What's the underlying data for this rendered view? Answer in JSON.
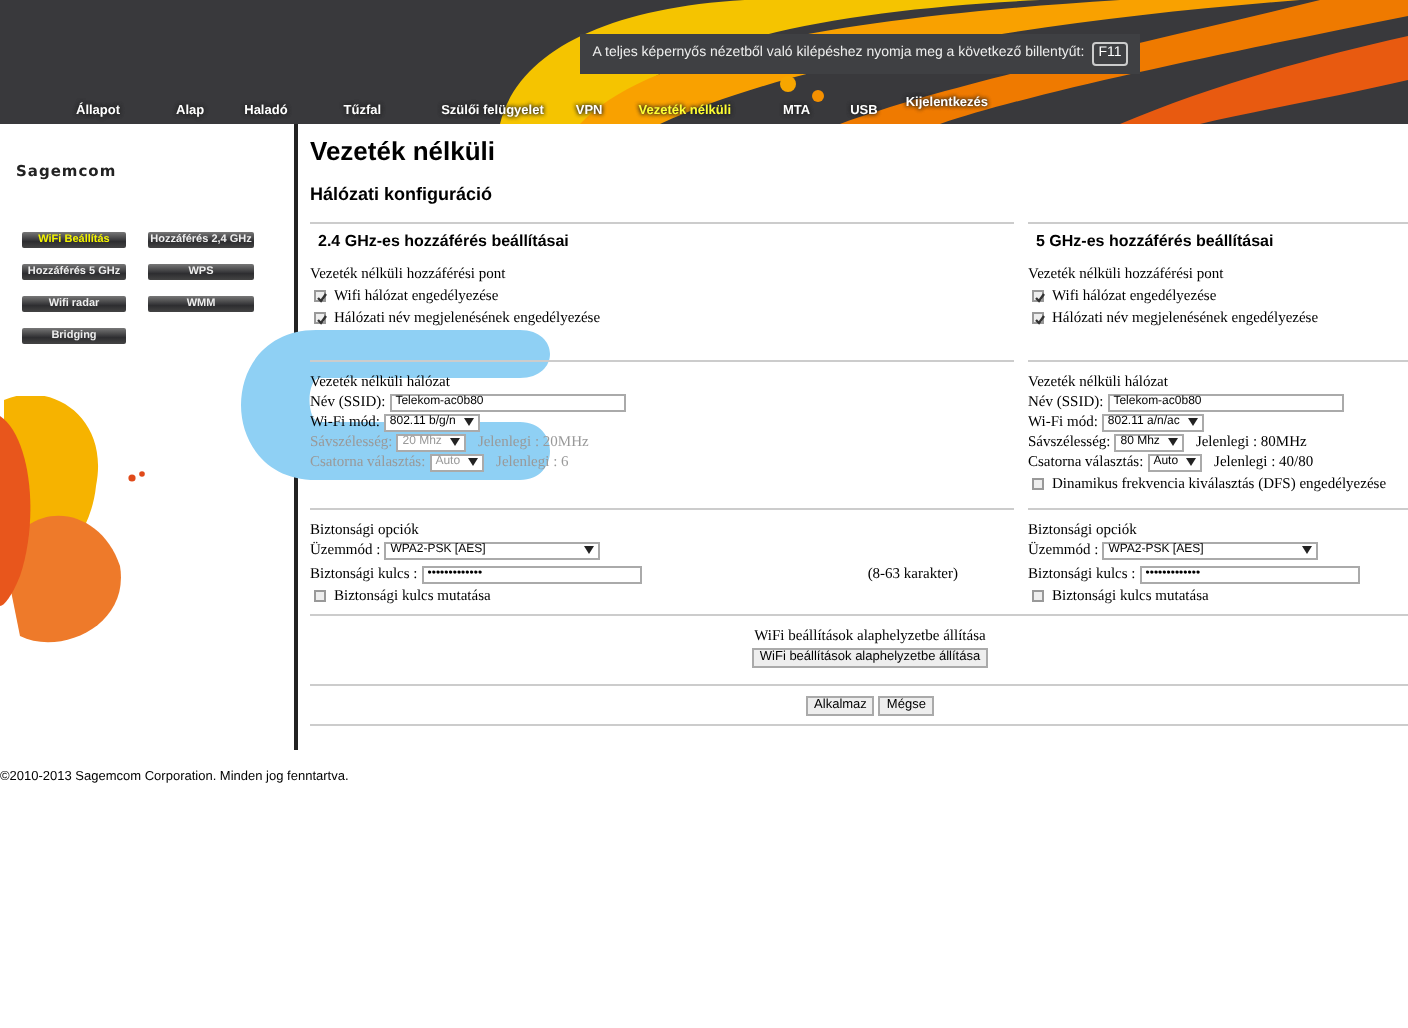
{
  "notice": {
    "text": "A teljes képernyős nézetből való kilépéshez nyomja meg a következő billentyűt:",
    "key": "F11"
  },
  "nav": [
    {
      "label": "Állapot",
      "selected": false
    },
    {
      "label": "Alap",
      "selected": false
    },
    {
      "label": "Haladó",
      "selected": false
    },
    {
      "label": "Tűzfal",
      "selected": false
    },
    {
      "label": "Szülői felügyelet",
      "selected": false
    },
    {
      "label": "VPN",
      "selected": false
    },
    {
      "label": "Vezeték nélküli",
      "selected": true
    },
    {
      "label": "MTA",
      "selected": false
    },
    {
      "label": "USB",
      "selected": false
    },
    {
      "label": "Kijelentkezés",
      "selected": false
    }
  ],
  "logo": "Sagemcom",
  "side_menu": [
    {
      "label": "WiFi Beállítás",
      "selected": true
    },
    {
      "label": "Hozzáférés 2,4 GHz",
      "selected": false
    },
    {
      "label": "Hozzáférés 5 GHz",
      "selected": false
    },
    {
      "label": "WPS",
      "selected": false
    },
    {
      "label": "Wifi radar",
      "selected": false
    },
    {
      "label": "WMM",
      "selected": false
    },
    {
      "label": "Bridging",
      "selected": false
    }
  ],
  "page_title": "Vezeték nélküli",
  "section_title": "Hálózati konfiguráció",
  "bands": [
    {
      "heading": "2.4 GHz-es hozzáférés beállításai",
      "access_point": {
        "label": "Vezeték nélküli hozzáférési pont",
        "options": [
          {
            "label": "Wifi hálózat engedélyezése",
            "checked": true
          },
          {
            "label": "Hálózati név megjelenésének engedélyezése",
            "checked": true
          }
        ]
      },
      "network": {
        "label": "Vezeték nélküli hálózat",
        "fields": [
          {
            "kind": "input",
            "label": "Név (SSID):",
            "value": "Telekom-ac0b80",
            "disabled": false
          },
          {
            "kind": "select",
            "label": "Wi-Fi mód:",
            "value": "802.11 b/g/n",
            "disabled": false
          },
          {
            "kind": "select",
            "label": "Sávszélesség:",
            "value": "20 Mhz",
            "current": "Jelenlegi :  20MHz",
            "disabled": true
          },
          {
            "kind": "select",
            "label": "Csatorna választás:",
            "value": "Auto",
            "current": "Jelenlegi :  6",
            "disabled": true
          }
        ]
      },
      "security": {
        "label": "Biztonsági opciók",
        "mode_label": "Üzemmód :",
        "mode": "WPA2-PSK [AES]",
        "key_label": "Biztonsági kulcs :",
        "key": "•••••••••••••",
        "hint": "(8-63 karakter)",
        "show_key": {
          "label": "Biztonsági kulcs mutatása",
          "checked": false
        }
      }
    },
    {
      "heading": "5 GHz-es hozzáférés beállításai",
      "access_point": {
        "label": "Vezeték nélküli hozzáférési pont",
        "options": [
          {
            "label": "Wifi hálózat engedélyezése",
            "checked": true
          },
          {
            "label": "Hálózati név megjelenésének engedélyezése",
            "checked": true
          }
        ]
      },
      "network": {
        "label": "Vezeték nélküli hálózat",
        "fields": [
          {
            "kind": "input",
            "label": "Név (SSID):",
            "value": "Telekom-ac0b80",
            "disabled": false
          },
          {
            "kind": "select",
            "label": "Wi-Fi mód:",
            "value": "802.11 a/n/ac",
            "disabled": false
          },
          {
            "kind": "select",
            "label": "Sávszélesség:",
            "value": "80 Mhz",
            "current": "Jelenlegi :  80MHz",
            "disabled": false
          },
          {
            "kind": "select",
            "label": "Csatorna választás:",
            "value": "Auto",
            "current": "Jelenlegi :  40/80",
            "disabled": false
          },
          {
            "kind": "checkbox",
            "label": "Dinamikus frekvencia kiválasztás (DFS) engedélyezése",
            "checked": false
          }
        ]
      },
      "security": {
        "label": "Biztonsági opciók",
        "mode_label": "Üzemmód :",
        "mode": "WPA2-PSK [AES]",
        "key_label": "Biztonsági kulcs :",
        "key": "•••••••••••••",
        "show_key": {
          "label": "Biztonsági kulcs mutatása",
          "checked": false
        }
      }
    }
  ],
  "reset": {
    "label": "WiFi beállítások alaphelyzetbe állítása",
    "button": "WiFi beállítások alaphelyzetbe állítása"
  },
  "buttons": [
    "Alkalmaz",
    "Mégse"
  ],
  "footer": "©2010-2013 Sagemcom Corporation. Minden jog fenntartva."
}
